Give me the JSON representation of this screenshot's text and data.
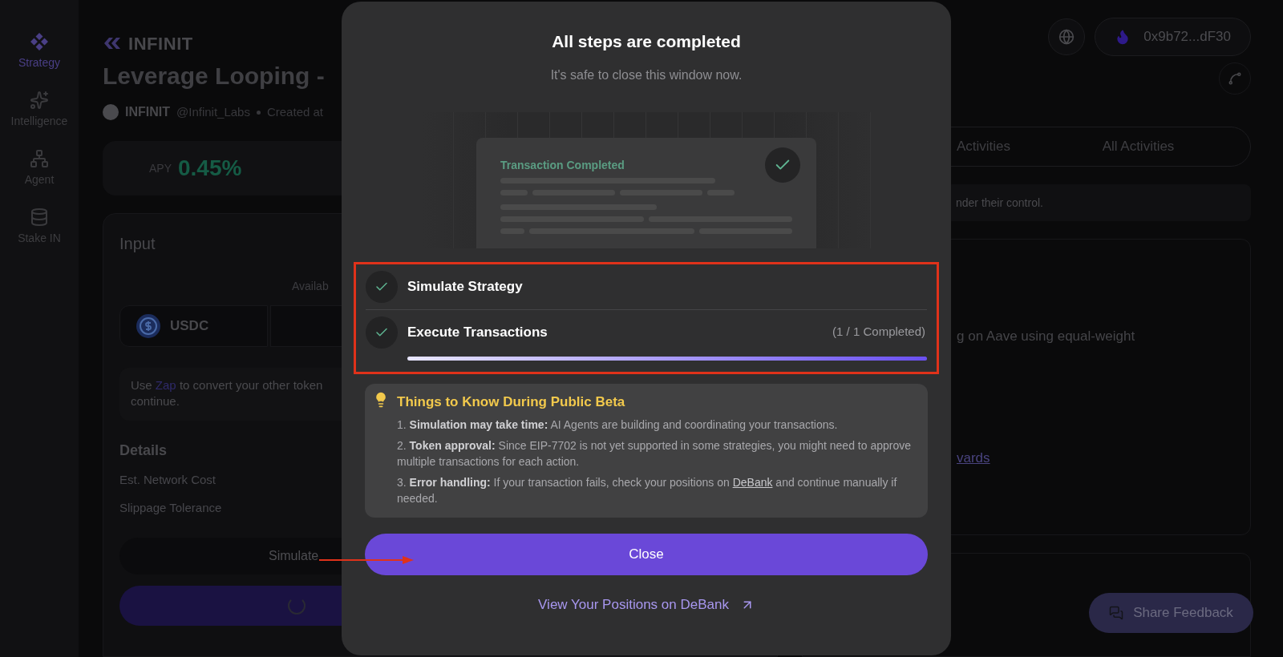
{
  "sidebar": {
    "items": [
      {
        "label": "Strategy",
        "selected": true
      },
      {
        "label": "Intelligence",
        "selected": false
      },
      {
        "label": "Agent",
        "selected": false
      },
      {
        "label": "Stake IN",
        "selected": false
      }
    ]
  },
  "header": {
    "logo": "INFINIT",
    "wallet": "0x9b72...dF30"
  },
  "strategy": {
    "title": "Leverage Looping -",
    "author": "INFINIT",
    "handle": "@Infinit_Labs",
    "created": "Created at",
    "apy_label": "APY",
    "apy": "0.45%"
  },
  "input_card": {
    "title": "Input",
    "available": "Availab",
    "token": "USDC",
    "zap_before": "Use",
    "zap_link": "Zap",
    "zap_after": "to convert your other token",
    "zap_line2": "continue.",
    "details_title": "Details",
    "details": [
      "Est. Network Cost",
      "Slippage Tolerance"
    ],
    "simulate": "Simulate"
  },
  "right": {
    "tabs": [
      "Activities",
      "All Activities"
    ],
    "notice": "nder their control.",
    "description": "g on Aave using equal-weight",
    "link": "vards",
    "feedback": "Share Feedback"
  },
  "modal": {
    "title": "All steps are completed",
    "subtitle": "It's safe to close this window now.",
    "illustration": {
      "title": "Transaction Completed"
    },
    "steps": [
      {
        "label": "Simulate Strategy",
        "done": true
      },
      {
        "label": "Execute Transactions",
        "done": true,
        "count": "(1 / 1 Completed)",
        "level": 1
      }
    ],
    "tips": {
      "title": "Things to Know During Public Beta",
      "items": [
        {
          "text": "1. **Simulation may take time:** AI Agents are building and coordinating your transactions."
        },
        {
          "text": "2. **Token approval:** Since EIP-7702 is not yet supported in some strategies, you might need to approve multiple transactions for each action."
        },
        {
          "text": "3. **Error handling:** If your transaction fails, check your positions on",
          "link": "DeBank",
          "after": "and continue manually if needed."
        }
      ]
    },
    "close": "Close",
    "debank_link": "View Your Positions on DeBank"
  }
}
